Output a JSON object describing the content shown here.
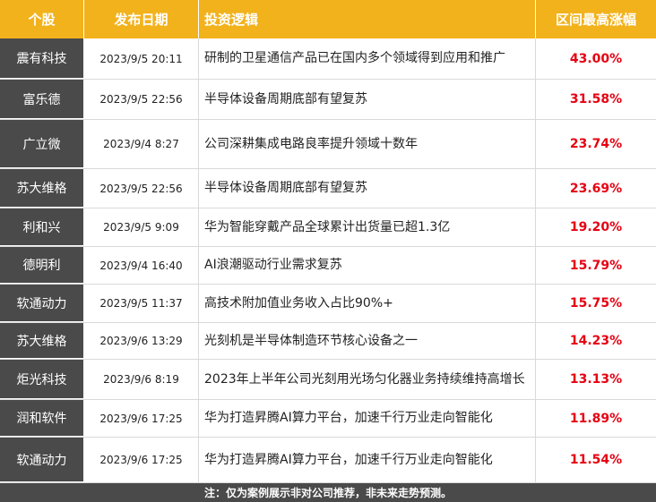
{
  "header": {
    "stock": "个股",
    "date": "发布日期",
    "logic": "投资逻辑",
    "gain": "区间最高涨幅"
  },
  "rows": [
    {
      "stock": "震有科技",
      "date": "2023/9/5 20:11",
      "logic": "研制的卫星通信产品已在国内多个领域得到应用和推广",
      "gain": "43.00%"
    },
    {
      "stock": "富乐德",
      "date": "2023/9/5 22:56",
      "logic": "半导体设备周期底部有望复苏",
      "gain": "31.58%"
    },
    {
      "stock": "广立微",
      "date": "2023/9/4 8:27",
      "logic": "公司深耕集成电路良率提升领域十数年",
      "gain": "23.74%"
    },
    {
      "stock": "苏大维格",
      "date": "2023/9/5 22:56",
      "logic": "半导体设备周期底部有望复苏",
      "gain": "23.69%"
    },
    {
      "stock": "利和兴",
      "date": "2023/9/5 9:09",
      "logic": "华为智能穿戴产品全球累计出货量已超1.3亿",
      "gain": "19.20%"
    },
    {
      "stock": "德明利",
      "date": "2023/9/4 16:40",
      "logic": "AI浪潮驱动行业需求复苏",
      "gain": "15.79%"
    },
    {
      "stock": "软通动力",
      "date": "2023/9/5 11:37",
      "logic": "高技术附加值业务收入占比90%+",
      "gain": "15.75%"
    },
    {
      "stock": "苏大维格",
      "date": "2023/9/6 13:29",
      "logic": "光刻机是半导体制造环节核心设备之一",
      "gain": "14.23%"
    },
    {
      "stock": "炬光科技",
      "date": "2023/9/6 8:19",
      "logic": "2023年上半年公司光刻用光场匀化器业务持续维持高增长",
      "gain": "13.13%"
    },
    {
      "stock": "润和软件",
      "date": "2023/9/6 17:25",
      "logic": "华为打造昇腾AI算力平台，加速千行万业走向智能化",
      "gain": "11.89%"
    },
    {
      "stock": "软通动力",
      "date": "2023/9/6 17:25",
      "logic": "华为打造昇腾AI算力平台，加速千行万业走向智能化",
      "gain": "11.54%"
    }
  ],
  "footer": "注：仅为案例展示非对公司推荐，非未来走势预测。",
  "colors": {
    "header_bg": "#f2b21c",
    "stock_bg": "#4a4a4a",
    "gain_text": "#e60012"
  }
}
